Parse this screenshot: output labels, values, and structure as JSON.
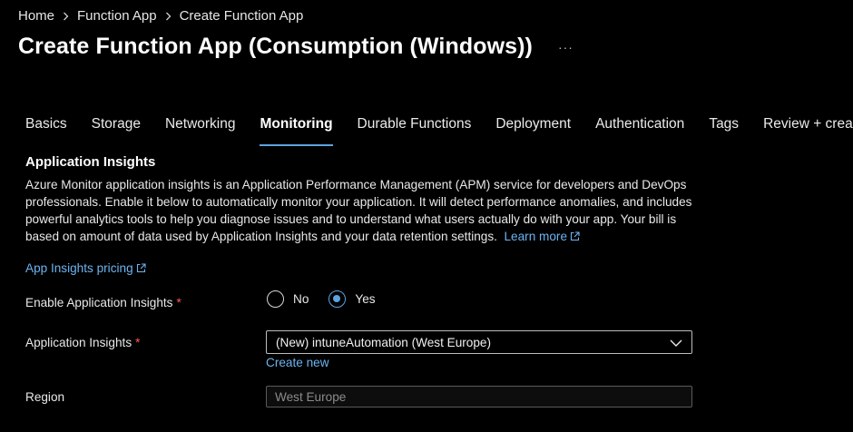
{
  "breadcrumb": {
    "items": [
      {
        "label": "Home"
      },
      {
        "label": "Function App"
      },
      {
        "label": "Create Function App"
      }
    ]
  },
  "header": {
    "title": "Create Function App (Consumption (Windows))",
    "more_label": "···"
  },
  "tabs": [
    {
      "label": "Basics",
      "active": false
    },
    {
      "label": "Storage",
      "active": false
    },
    {
      "label": "Networking",
      "active": false
    },
    {
      "label": "Monitoring",
      "active": true
    },
    {
      "label": "Durable Functions",
      "active": false
    },
    {
      "label": "Deployment",
      "active": false
    },
    {
      "label": "Authentication",
      "active": false
    },
    {
      "label": "Tags",
      "active": false
    },
    {
      "label": "Review + create",
      "active": false
    }
  ],
  "section": {
    "title": "Application Insights",
    "description": "Azure Monitor application insights is an Application Performance Management (APM) service for developers and DevOps professionals. Enable it below to automatically monitor your application. It will detect performance anomalies, and includes powerful analytics tools to help you diagnose issues and to understand what users actually do with your app. Your bill is based on amount of data used by Application Insights and your data retention settings.",
    "learn_more_label": "Learn more",
    "pricing_link_label": "App Insights pricing"
  },
  "form": {
    "enable_label": "Enable Application Insights",
    "required_mark": "*",
    "radio_no_label": "No",
    "radio_yes_label": "Yes",
    "selected_option": "Yes",
    "app_insights_label": "Application Insights",
    "app_insights_value": "(New) intuneAutomation (West Europe)",
    "create_new_label": "Create new",
    "region_label": "Region",
    "region_value": "West Europe"
  },
  "colors": {
    "background": "#000000",
    "accent": "#5ba4e0",
    "link": "#6cb4f0",
    "required": "#ff5a5a"
  },
  "icons": [
    "chevron-right-icon",
    "more-icon",
    "external-link-icon",
    "chevron-down-icon"
  ]
}
